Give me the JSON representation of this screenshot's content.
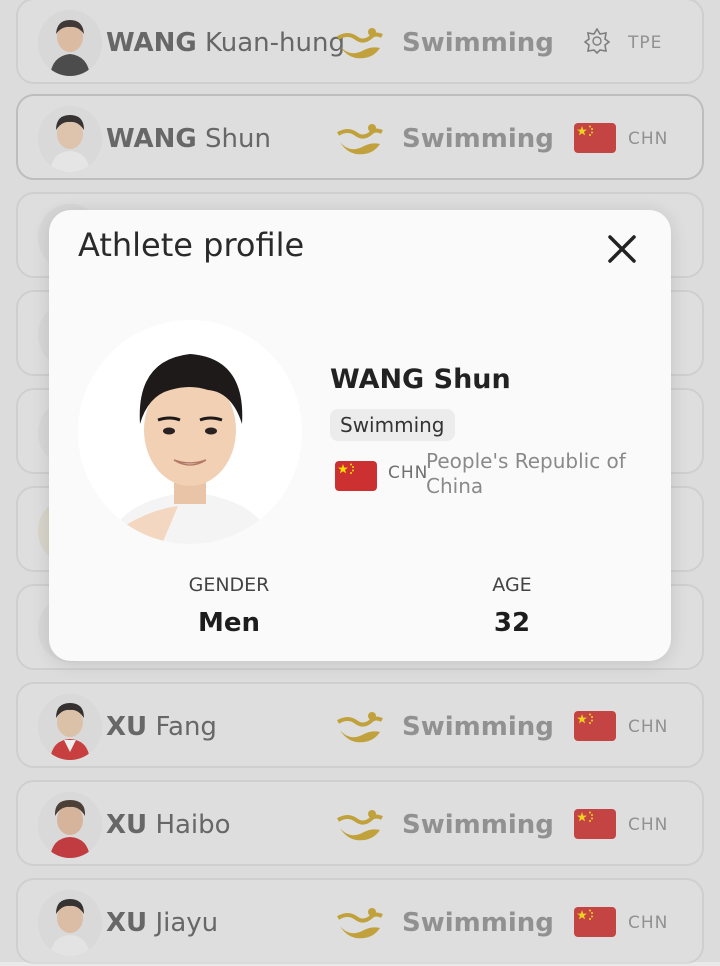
{
  "list": {
    "rows": [
      {
        "last": "WANG",
        "first": "Kuan-hung",
        "sport": "Swimming",
        "noc": "TPE",
        "flag": "tpe"
      },
      {
        "last": "WANG",
        "first": "Shun",
        "sport": "Swimming",
        "noc": "CHN",
        "flag": "chn"
      },
      {
        "last": "",
        "first": "",
        "sport": "",
        "noc": "",
        "flag": "hidden"
      },
      {
        "last": "",
        "first": "",
        "sport": "",
        "noc": "",
        "flag": "hidden"
      },
      {
        "last": "",
        "first": "",
        "sport": "",
        "noc": "",
        "flag": "hidden"
      },
      {
        "last": "",
        "first": "",
        "sport": "",
        "noc": "",
        "flag": "hidden"
      },
      {
        "last": "",
        "first": "",
        "sport": "",
        "noc": "",
        "flag": "hidden"
      },
      {
        "last": "XU",
        "first": "Fang",
        "sport": "Swimming",
        "noc": "CHN",
        "flag": "chn"
      },
      {
        "last": "XU",
        "first": "Haibo",
        "sport": "Swimming",
        "noc": "CHN",
        "flag": "chn"
      },
      {
        "last": "XU",
        "first": "Jiayu",
        "sport": "Swimming",
        "noc": "CHN",
        "flag": "chn"
      }
    ]
  },
  "modal": {
    "title": "Athlete profile",
    "close_icon": "close-icon",
    "athlete": {
      "name": "WANG Shun",
      "sport": "Swimming",
      "noc": "CHN",
      "country": "People's Republic of China",
      "gender_label": "GENDER",
      "gender": "Men",
      "age_label": "AGE",
      "age": "32"
    }
  },
  "colors": {
    "flag_red": "#cc3030",
    "flag_star": "#ffde00",
    "sport_icon_gold": "#c9a227",
    "backdrop": "#e9e9e9",
    "modal_bg": "#fafafa"
  }
}
